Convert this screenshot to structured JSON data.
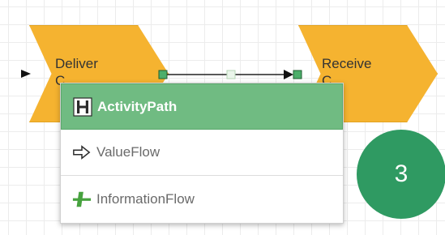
{
  "canvas": {
    "shapes": [
      {
        "line1": "Deliver",
        "line2": "C",
        "color": "#f5b330"
      },
      {
        "line1": "Receive",
        "line2": "C",
        "color": "#f5b330"
      }
    ]
  },
  "connector_menu": {
    "items": [
      {
        "label": "ActivityPath",
        "icon": "activity-path-icon",
        "active": true,
        "accent": "#70bb82"
      },
      {
        "label": "ValueFlow",
        "icon": "value-flow-icon",
        "active": false
      },
      {
        "label": "InformationFlow",
        "icon": "information-flow-icon",
        "active": false,
        "accent": "#47a23f"
      }
    ]
  },
  "step_badge": {
    "number": "3",
    "color": "#2f9a62"
  }
}
